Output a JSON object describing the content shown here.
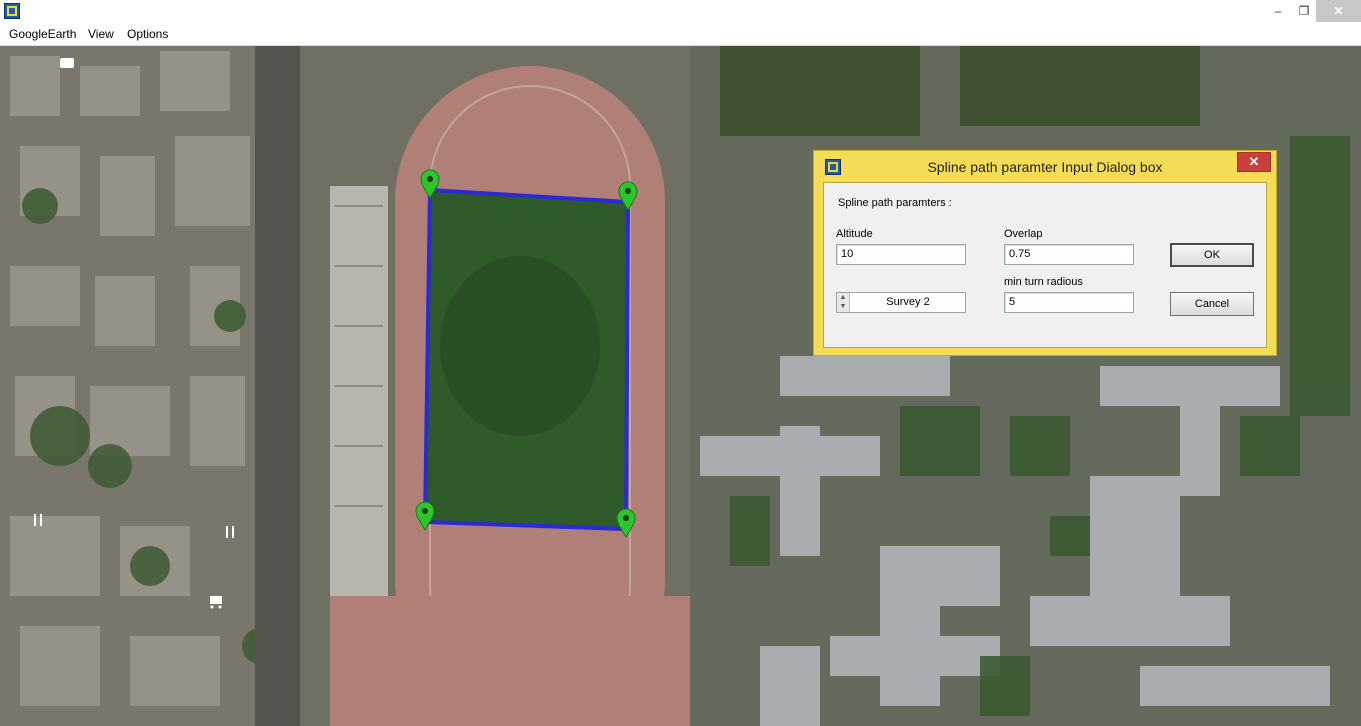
{
  "window": {
    "menu": [
      "GoogleEarth",
      "View",
      "Options"
    ],
    "controls": {
      "minimize": "‒",
      "maximize": "❐",
      "close": "✕"
    }
  },
  "dialog": {
    "title": "Spline path  paramter Input Dialog box",
    "close": "✕",
    "section_label": "Spline path  paramters :",
    "altitude_label": "Altitude",
    "altitude_value": "10",
    "overlap_label": "Overlap",
    "overlap_value": "0.75",
    "min_turn_label": "min turn radious",
    "min_turn_value": "5",
    "survey_value": "Survey 2",
    "ok_label": "OK",
    "cancel_label": "Cancel"
  },
  "map": {
    "marker_color": "#2ec42e",
    "path_color": "#2a2ad6",
    "marker_count": 4
  }
}
